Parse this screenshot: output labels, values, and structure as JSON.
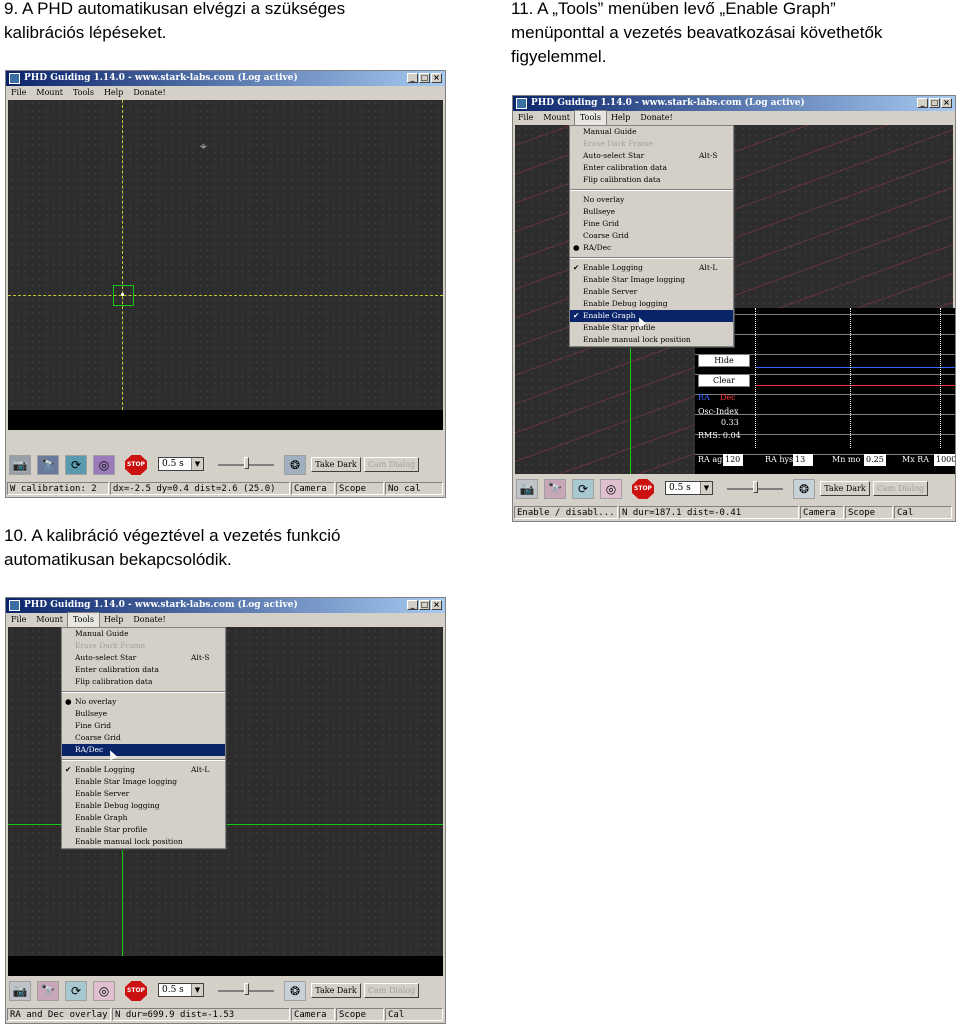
{
  "captions": {
    "c9": [
      "9. A PHD automatikusan elvégzi a szükséges",
      "kalibrációs lépéseket."
    ],
    "c11": [
      "11. A „Tools” menüben levő „Enable Graph”",
      "menüponttal a vezetés beavatkozásai követhetők",
      "figyelemmel."
    ],
    "c10": [
      "10. A kalibráció végeztével a vezetés funkció",
      "automatikusan bekapcsolódik."
    ]
  },
  "app": {
    "title": "PHD Guiding 1.14.0  -  www.stark-labs.com (Log active)",
    "menus": [
      "File",
      "Mount",
      "Tools",
      "Help",
      "Donate!"
    ],
    "exposure": "0.5 s",
    "take_dark": "Take Dark",
    "cam_dialog": "Cam Dialog",
    "camera": "Camera",
    "scope": "Scope",
    "stop": "STOP"
  },
  "window_9": {
    "status": "W calibration: 2",
    "stats": "dx=-2.5 dy=0.4 dist=2.6 (25.0)",
    "cal": "No cal"
  },
  "window_10": {
    "status": "RA and Dec overlay",
    "stats": "N dur=699.9 dist=-1.53",
    "cal": "Cal"
  },
  "window_11": {
    "status": "Enable / disabl...",
    "stats": "N dur=187.1 dist=-0.41",
    "cal": "Cal"
  },
  "tools_menu": {
    "group1": [
      {
        "label": "Manual Guide"
      },
      {
        "label": "Erase Dark Frame",
        "disabled": true
      },
      {
        "label": "Auto-select Star",
        "shortcut": "Alt-S"
      },
      {
        "label": "Enter calibration data"
      },
      {
        "label": "Flip calibration data"
      }
    ],
    "group2": [
      "No overlay",
      "Bullseye",
      "Fine Grid",
      "Coarse Grid",
      "RA/Dec"
    ],
    "group3": [
      {
        "label": "Enable Logging",
        "shortcut": "Alt-L"
      },
      {
        "label": "Enable Star Image logging"
      },
      {
        "label": "Enable Server"
      },
      {
        "label": "Enable Debug logging"
      },
      {
        "label": "Enable Graph"
      },
      {
        "label": "Enable Star profile"
      },
      {
        "label": "Enable manual lock position"
      }
    ]
  },
  "graph": {
    "hide": "Hide",
    "clear": "Clear",
    "ra": "RA",
    "dec": "Dec",
    "osc_label": "Osc-Index",
    "osc_value": "0.33",
    "rms": "RMS: 0.04",
    "ra_agr_label": "RA agr",
    "ra_agr": "120",
    "ra_hys_label": "RA hys",
    "ra_hys": "13",
    "mn_mo_label": "Mn mo",
    "mn_mo": "0.25",
    "mx_ra_label": "Mx RA",
    "mx_ra": "1000"
  },
  "colors": {
    "title_start": "#0a246a",
    "title_end": "#a6caf0",
    "crosshair_yellow": "#c8c832",
    "crosshair_green": "#14c814",
    "ra_red": "#ff3333",
    "dec_blue": "#3366ff"
  }
}
